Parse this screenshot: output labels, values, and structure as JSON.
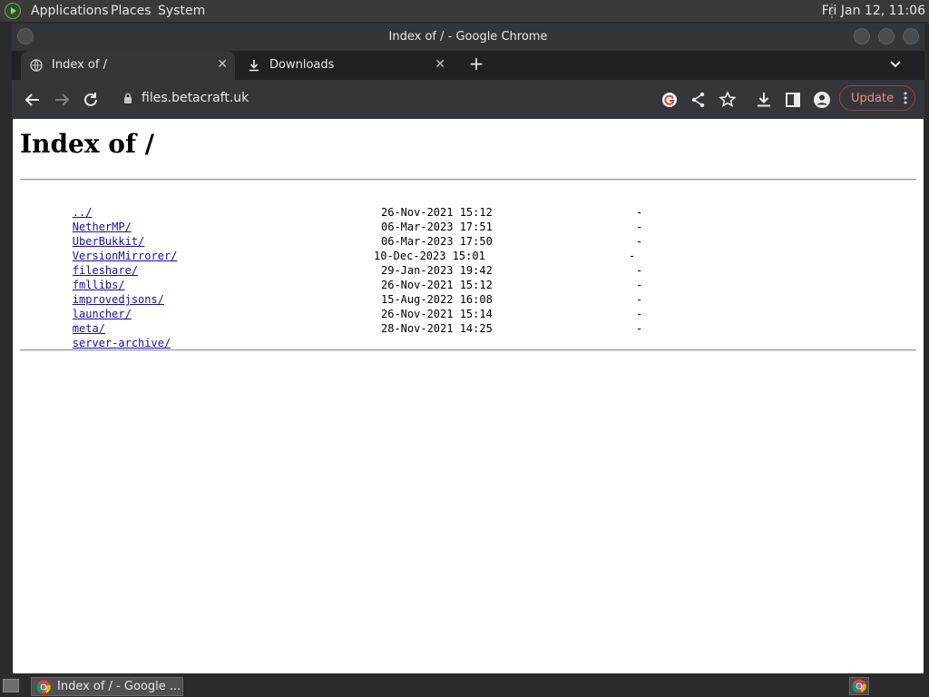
{
  "top_panel": {
    "menus": [
      "Applications",
      "Places",
      "System"
    ],
    "clock": "Fri Jan 12, 11:06"
  },
  "window": {
    "title": "Index of / - Google Chrome"
  },
  "tabs": [
    {
      "label": "Index of /",
      "icon": "globe-icon",
      "active": true
    },
    {
      "label": "Downloads",
      "icon": "download-icon",
      "active": false
    }
  ],
  "toolbar": {
    "url": "files.betacraft.uk",
    "update_label": "Update"
  },
  "page": {
    "heading": "Index of /",
    "parent_link": "../",
    "entries": [
      {
        "name": "NetherMP/",
        "date": "26-Nov-2021 15:12",
        "size": "-"
      },
      {
        "name": "UberBukkit/",
        "date": "06-Mar-2023 17:51",
        "size": "-"
      },
      {
        "name": "VersionMirrorer/",
        "date": "06-Mar-2023 17:50",
        "size": "-"
      },
      {
        "name": "fileshare/",
        "date": "10-Dec-2023 15:01",
        "size": "-"
      },
      {
        "name": "fmllibs/",
        "date": "29-Jan-2023 19:42",
        "size": "-"
      },
      {
        "name": "improvedjsons/",
        "date": "26-Nov-2021 15:12",
        "size": "-"
      },
      {
        "name": "launcher/",
        "date": "15-Aug-2022 16:08",
        "size": "-"
      },
      {
        "name": "meta/",
        "date": "26-Nov-2021 15:14",
        "size": "-"
      },
      {
        "name": "server-archive/",
        "date": "28-Nov-2021 14:25",
        "size": "-"
      }
    ]
  },
  "taskbar": {
    "task_label": "Index of / - Google ..."
  },
  "colors": {
    "link": "#1a0dab",
    "update_accent": "#f28b82",
    "chrome_toolbar": "#35363a"
  }
}
